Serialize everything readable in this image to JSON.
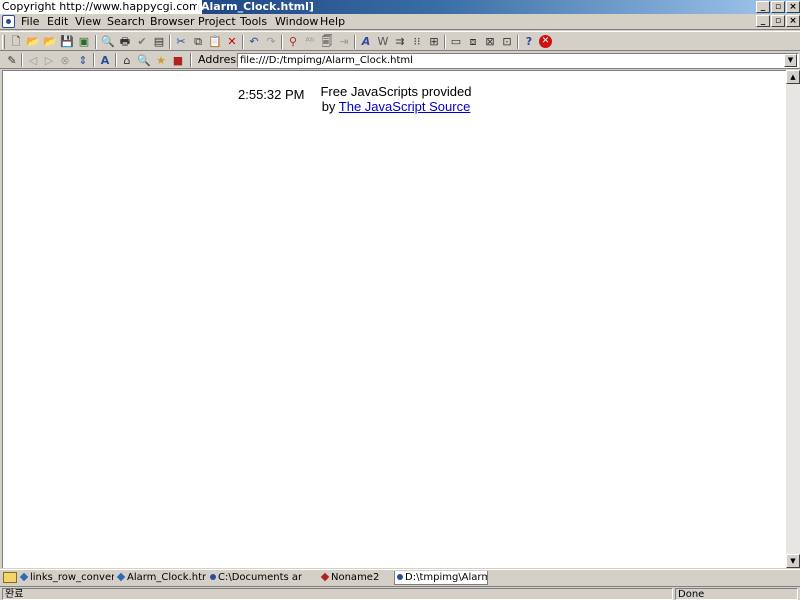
{
  "window": {
    "copyright": "Copyright   http://www.happycgi.com",
    "title": "[Alarm_Clock.html]"
  },
  "menu": [
    "File",
    "Edit",
    "View",
    "Search",
    "Browser",
    "Project",
    "Tools",
    "Window",
    "Help"
  ],
  "address": {
    "label": "Address",
    "value": "file:///D:/tmpimg/Alarm_Clock.html"
  },
  "page": {
    "time": "2:55:32 PM",
    "credit_line1": "Free JavaScripts provided",
    "credit_by": "by ",
    "credit_link": "The JavaScript Source"
  },
  "tabs": [
    {
      "label": "links_row_convert.i",
      "active": false,
      "color": "#2b6cb0"
    },
    {
      "label": "Alarm_Clock.html",
      "active": false,
      "color": "#2b6cb0"
    },
    {
      "label": "C:\\Documents an",
      "active": false,
      "color": "#2b4c9c"
    },
    {
      "label": "Noname2",
      "active": false,
      "color": "#b22222"
    },
    {
      "label": "D:\\tmpimg\\Alarm",
      "active": true,
      "color": "#2b4c9c"
    }
  ],
  "status": {
    "left": "완료",
    "right": "Done"
  }
}
